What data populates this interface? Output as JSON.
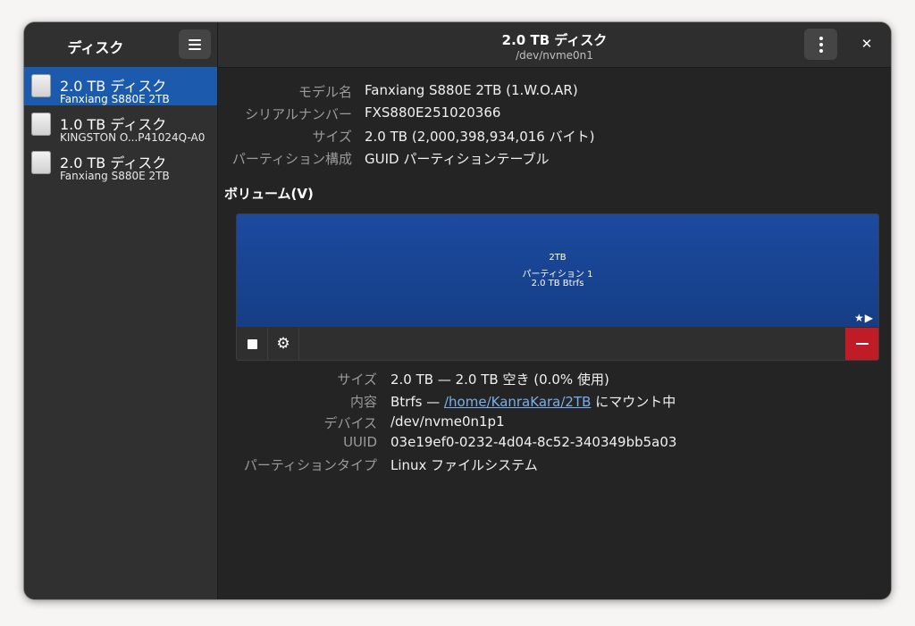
{
  "sidebar": {
    "title": "ディスク",
    "menu_icon": "hamburger-menu-icon",
    "disks": [
      {
        "name": "2.0 TB ディスク",
        "model": "Fanxiang S880E 2TB",
        "selected": true
      },
      {
        "name": "1.0 TB ディスク",
        "model": "KINGSTON O...P41024Q-A0",
        "selected": false
      },
      {
        "name": "2.0 TB ディスク",
        "model": "Fanxiang S880E 2TB",
        "selected": false
      }
    ]
  },
  "header": {
    "title": "2.0 TB ディスク",
    "subtitle": "/dev/nvme0n1",
    "kebab_icon": "more-vertical-icon",
    "close_icon": "close-icon",
    "close_glyph": "✕"
  },
  "disk_info": [
    {
      "label": "モデル名",
      "value": "Fanxiang S880E 2TB (1.W.O.AR)"
    },
    {
      "label": "シリアルナンバー",
      "value": "FXS880E251020366"
    },
    {
      "label": "サイズ",
      "value": "2.0 TB (2,000,398,934,016 バイト)"
    },
    {
      "label": "パーティション構成",
      "value": "GUID パーティションテーブル"
    }
  ],
  "volumes": {
    "title": "ボリューム(V)",
    "partition": {
      "line1": "2TB",
      "line2": "パーティション 1",
      "line3": "2.0 TB Btrfs",
      "icons": "★▶"
    },
    "toolbar": {
      "stop_icon": "stop-icon",
      "settings_icon": "settings-gear-icon",
      "gear_glyph": "⚙",
      "delete_icon": "minus-icon"
    }
  },
  "partition_info": {
    "size_label": "サイズ",
    "size_value": "2.0 TB — 2.0 TB 空き (0.0% 使用)",
    "content_label": "内容",
    "content_prefix": "Btrfs — ",
    "content_link": "/home/KanraKara/2TB",
    "content_suffix": " にマウント中",
    "device_label": "デバイス",
    "device_value": "/dev/nvme0n1p1",
    "uuid_label": "UUID",
    "uuid_value": "03e19ef0-0232-4d04-8c52-340349bb5a03",
    "type_label": "パーティションタイプ",
    "type_value": "Linux ファイルシステム"
  },
  "colors": {
    "accent": "#1c5aad",
    "partition": "#1c4aa0",
    "destructive": "#c01c28",
    "link": "#78aeed"
  }
}
